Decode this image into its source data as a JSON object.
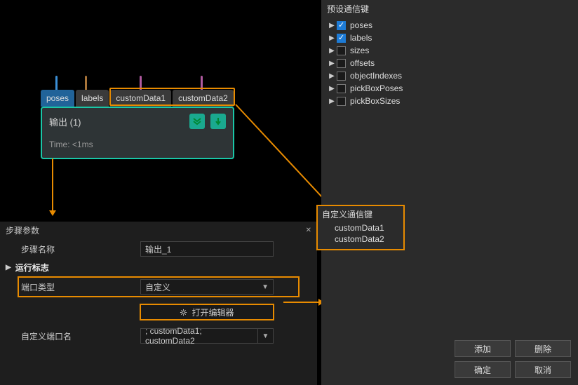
{
  "node": {
    "ports": [
      "poses",
      "labels",
      "customData1",
      "customData2"
    ],
    "title": "输出 (1)",
    "time": "Time: <1ms"
  },
  "params": {
    "header": "步骤参数",
    "stepNameLabel": "步骤名称",
    "stepNameValue": "输出_1",
    "runFlagLabel": "运行标志",
    "portTypeLabel": "端口类型",
    "portTypeValue": "自定义",
    "openEditorLabel": "打开编辑器",
    "customPortLabel": "自定义端口名",
    "customPortValue": "; customData1; customData2"
  },
  "side": {
    "presetTitle": "预设通信键",
    "tree": [
      {
        "label": "poses",
        "checked": true
      },
      {
        "label": "labels",
        "checked": true
      },
      {
        "label": "sizes",
        "checked": false
      },
      {
        "label": "offsets",
        "checked": false
      },
      {
        "label": "objectIndexes",
        "checked": false
      },
      {
        "label": "pickBoxPoses",
        "checked": false
      },
      {
        "label": "pickBoxSizes",
        "checked": false
      }
    ],
    "customTitle": "自定义通信键",
    "customItems": [
      "customData1",
      "customData2"
    ],
    "buttons": {
      "add": "添加",
      "delete": "删除",
      "ok": "确定",
      "cancel": "取消"
    }
  }
}
